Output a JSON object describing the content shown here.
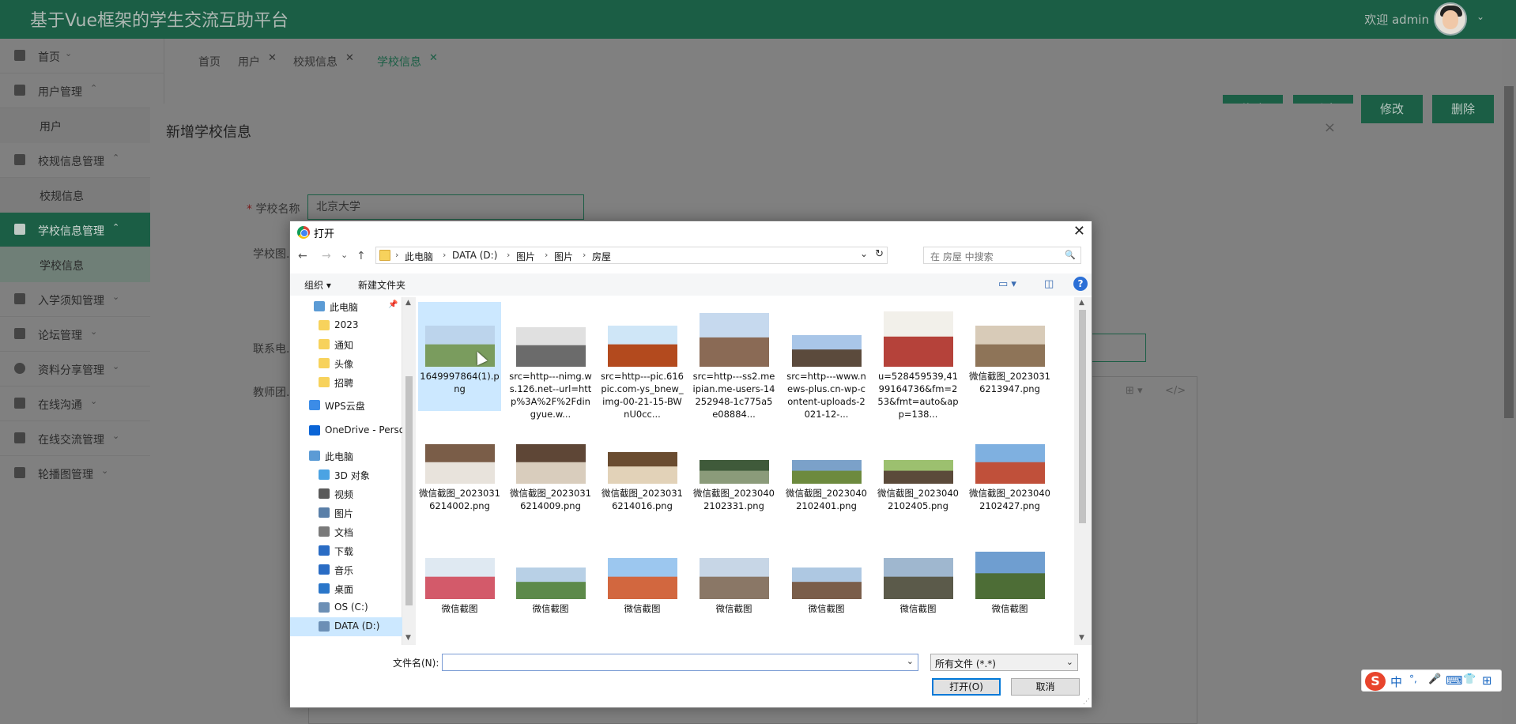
{
  "app": {
    "title": "基于Vue框架的学生交流互助平台",
    "welcome": "欢迎 admin"
  },
  "sidebar": {
    "items": [
      {
        "label": "首页",
        "chevron": "⌄"
      },
      {
        "label": "用户管理",
        "chevron": "⌃"
      },
      {
        "label": "用户"
      },
      {
        "label": "校规信息管理",
        "chevron": "⌃"
      },
      {
        "label": "校规信息"
      },
      {
        "label": "学校信息管理",
        "chevron": "⌃"
      },
      {
        "label": "学校信息"
      },
      {
        "label": "入学须知管理",
        "chevron": "⌄"
      },
      {
        "label": "论坛管理",
        "chevron": "⌄"
      },
      {
        "label": "资料分享管理",
        "chevron": "⌄"
      },
      {
        "label": "在线沟通",
        "chevron": "⌄"
      },
      {
        "label": "在线交流管理",
        "chevron": "⌄"
      },
      {
        "label": "轮播图管理",
        "chevron": "⌄"
      }
    ]
  },
  "tabs": [
    {
      "label": "首页"
    },
    {
      "label": "用户"
    },
    {
      "label": "校规信息"
    },
    {
      "label": "学校信息"
    }
  ],
  "actions": {
    "edit": "修改",
    "delete": "删除"
  },
  "modal": {
    "title": "新增学校信息",
    "close": "×",
    "fields": {
      "school_name_label": "学校名称",
      "school_name_value": "北京大学",
      "school_image_label": "学校图...",
      "contact_label": "联系电...",
      "team_label": "教师团..."
    }
  },
  "dialog": {
    "title": "打开",
    "close": "✕",
    "nav": {
      "back": "←",
      "forward": "→",
      "down": "⌄",
      "up": "↑"
    },
    "breadcrumb": [
      "此电脑",
      "DATA (D:)",
      "图片",
      "图片",
      "房屋"
    ],
    "search_placeholder": "在 房屋 中搜索",
    "toolbar": {
      "organize": "组织 ▾",
      "new_folder": "新建文件夹",
      "help": "?"
    },
    "nav_pane": [
      {
        "label": "此电脑",
        "icon": "computer-icon",
        "color": "#5b9bd5"
      },
      {
        "label": "2023",
        "icon": "folder-icon",
        "color": "#f7d25c"
      },
      {
        "label": "通知",
        "icon": "folder-icon",
        "color": "#f7d25c"
      },
      {
        "label": "头像",
        "icon": "folder-icon",
        "color": "#f7d25c"
      },
      {
        "label": "招聘",
        "icon": "folder-icon",
        "color": "#f7d25c"
      },
      {
        "label": "WPS云盘",
        "icon": "cloud-icon",
        "color": "#3c8ce7"
      },
      {
        "label": "OneDrive - Perso",
        "icon": "cloud-icon",
        "color": "#0a64d6"
      },
      {
        "label": "此电脑",
        "icon": "computer-icon",
        "color": "#5b9bd5"
      },
      {
        "label": "3D 对象",
        "icon": "cube-icon",
        "color": "#4ba3e3"
      },
      {
        "label": "视频",
        "icon": "video-icon",
        "color": "#5a5a5a"
      },
      {
        "label": "图片",
        "icon": "pictures-icon",
        "color": "#5a7fa8"
      },
      {
        "label": "文档",
        "icon": "document-icon",
        "color": "#7a7a7a"
      },
      {
        "label": "下载",
        "icon": "download-icon",
        "color": "#2a6cc4"
      },
      {
        "label": "音乐",
        "icon": "music-icon",
        "color": "#2a6cc4"
      },
      {
        "label": "桌面",
        "icon": "desktop-icon",
        "color": "#2a76c9"
      },
      {
        "label": "OS (C:)",
        "icon": "drive-icon",
        "color": "#6c8fb5"
      },
      {
        "label": "DATA (D:)",
        "icon": "drive-icon",
        "color": "#6c8fb5"
      }
    ],
    "files": [
      {
        "name": "1649997864(1).png",
        "colors": [
          "#bcd4ec",
          "#7a9c5e"
        ]
      },
      {
        "name": "src=http---nimg.ws.126.net--url=http%3A%2F%2Fdingyue.w...",
        "colors": [
          "#e0e0e0",
          "#6b6b6b"
        ]
      },
      {
        "name": "src=http---pic.616pic.com-ys_bnew_img-00-21-15-BWnU0cc...",
        "colors": [
          "#cfe6f7",
          "#b34a1e"
        ]
      },
      {
        "name": "src=http---ss2.meipian.me-users-14252948-1c775a5e08884...",
        "colors": [
          "#c6d9ee",
          "#8a6a55"
        ]
      },
      {
        "name": "src=http---www.news-plus.cn-wp-content-uploads-2021-12-...",
        "colors": [
          "#a9c6e8",
          "#5b4a3c"
        ]
      },
      {
        "name": "u=528459539,4199164736&fm=253&fmt=auto&app=138...",
        "colors": [
          "#f2f0ea",
          "#b5423a"
        ]
      },
      {
        "name": "微信截图_20230316213947.png",
        "colors": [
          "#d8cbb8",
          "#8e7458"
        ]
      },
      {
        "name": "微信截图_20230316214002.png",
        "colors": [
          "#7a5d48",
          "#e8e3dc"
        ]
      },
      {
        "name": "微信截图_20230316214009.png",
        "colors": [
          "#5e4636",
          "#d9cdbd"
        ]
      },
      {
        "name": "微信截图_20230316214016.png",
        "colors": [
          "#6a4c30",
          "#e2d2b8"
        ]
      },
      {
        "name": "微信截图_20230402102331.png",
        "colors": [
          "#3f5a3a",
          "#8b9b7a"
        ]
      },
      {
        "name": "微信截图_20230402102401.png",
        "colors": [
          "#7ba1c9",
          "#6d8a3e"
        ]
      },
      {
        "name": "微信截图_20230402102405.png",
        "colors": [
          "#9cc06f",
          "#5b4a3a"
        ]
      },
      {
        "name": "微信截图_20230402102427.png",
        "colors": [
          "#7fb0e0",
          "#c0503a"
        ]
      },
      {
        "name": "微信截图",
        "colors": [
          "#dfe9f2",
          "#d35a6a"
        ]
      },
      {
        "name": "微信截图",
        "colors": [
          "#b8d0e6",
          "#5d8a4a"
        ]
      },
      {
        "name": "微信截图",
        "colors": [
          "#9cc7ef",
          "#d2673f"
        ]
      },
      {
        "name": "微信截图",
        "colors": [
          "#c7d6e6",
          "#8a7766"
        ]
      },
      {
        "name": "微信截图",
        "colors": [
          "#aec8e2",
          "#7a5e4a"
        ]
      },
      {
        "name": "微信截图",
        "colors": [
          "#9fb7cf",
          "#5b5a4a"
        ]
      },
      {
        "name": "微信截图",
        "colors": [
          "#6f9ed0",
          "#4d6d36"
        ]
      }
    ],
    "filename_label": "文件名(N):",
    "filename_value": "",
    "filetype": "所有文件 (*.*)",
    "open_button": "打开(O)",
    "cancel_button": "取消"
  },
  "ime": {
    "logo": "S",
    "items": [
      "中",
      "°,",
      "🎤",
      "⌨",
      "👕",
      "⊞"
    ]
  }
}
